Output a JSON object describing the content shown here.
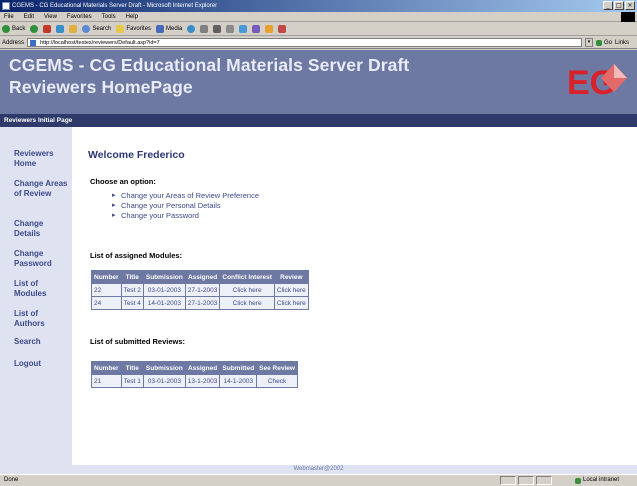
{
  "window": {
    "title": "CGEMS - CG Educational Materials Server Draft - Microsoft Internet Explorer",
    "controls": [
      "_",
      "□",
      "×"
    ]
  },
  "menu": [
    "File",
    "Edit",
    "View",
    "Favorites",
    "Tools",
    "Help"
  ],
  "toolbar": {
    "back": "Back",
    "search": "Search",
    "favorites": "Favorites",
    "media": "Media"
  },
  "address": {
    "label": "Address",
    "url": "http://localhost/testes/reviewers/Default.asp?id=7",
    "go": "Go",
    "links": "Links"
  },
  "header": {
    "title_line1": "CGEMS - CG Educational Materials Server Draft",
    "title_line2": "Reviewers HomePage",
    "logo_text": "EG"
  },
  "subbar": "Reviewers Initial Page",
  "sidebar": [
    "Reviewers Home",
    "Change Areas of Review",
    "Change Details",
    "Change Password",
    "List of Modules",
    "List of Authors",
    "Search",
    "Logout"
  ],
  "main": {
    "welcome": "Welcome Frederico",
    "choose": "Choose an option:",
    "options": [
      "Change your Areas of Review Preference",
      "Change your Personal Details",
      "Change your Password"
    ],
    "assigned_title": "List of assigned Modules:",
    "assigned_headers": [
      "Number",
      "Title",
      "Submission",
      "Assigned",
      "Conflict Interest",
      "Review"
    ],
    "assigned_rows": [
      [
        "22",
        "Test 2",
        "03-01-2003",
        "27-1-2003",
        "Click here",
        "Click here"
      ],
      [
        "24",
        "Test 4",
        "14-01-2003",
        "27-1-2003",
        "Click here",
        "Click here"
      ]
    ],
    "submitted_title": "List of submitted Reviews:",
    "submitted_headers": [
      "Number",
      "Title",
      "Submission",
      "Assigned",
      "Submitted",
      "See Review"
    ],
    "submitted_rows": [
      [
        "21",
        "Test 1",
        "03-01-2003",
        "13-1-2003",
        "14-1-2003",
        "Check"
      ]
    ]
  },
  "footer": "Webmaster@2002",
  "status": {
    "left": "Done",
    "zone": "Local intranet"
  },
  "colors": {
    "header": "#6d78a3",
    "subbar": "#2f3a6a",
    "sidebar": "#dfe3f1",
    "link": "#3d4a8a",
    "logo_red": "#d9212a"
  }
}
